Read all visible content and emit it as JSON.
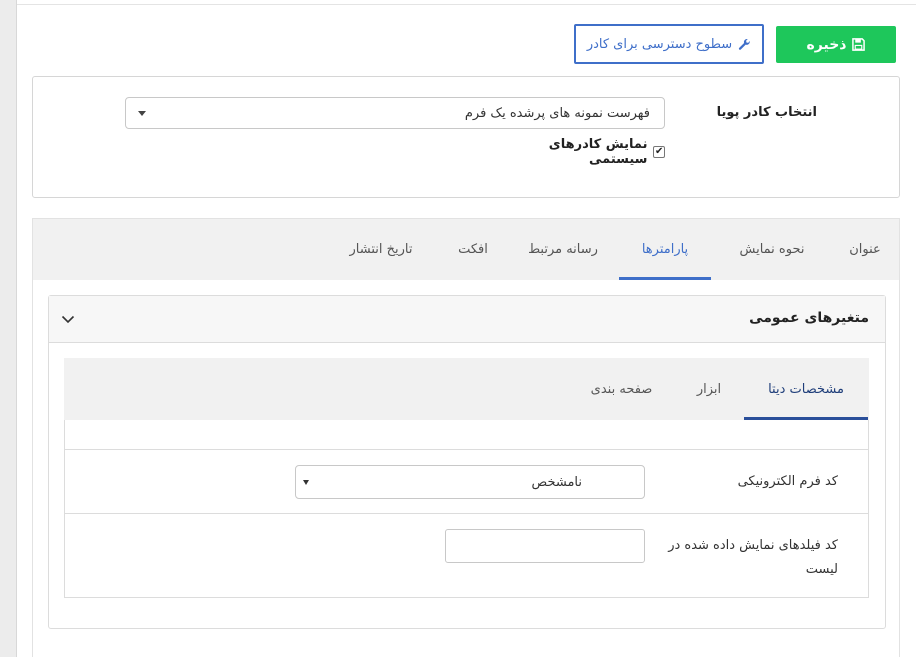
{
  "toolbar": {
    "save_label": "ذخیره",
    "save_icon": "floppy-disk-icon",
    "access_label": "سطوح دسترسی برای کادر",
    "access_icon": "wrench-icon"
  },
  "frame": {
    "label": "انتخاب کادر پویا",
    "selected": "فهرست نمونه های پرشده یک فرم",
    "show_system_label": "نمایش کادرهای سیستمی",
    "show_system_checked": true
  },
  "tabs": [
    {
      "label": "عنوان",
      "active": false
    },
    {
      "label": "نحوه نمایش",
      "active": false
    },
    {
      "label": "پارامترها",
      "active": true
    },
    {
      "label": "رسانه مرتبط",
      "active": false
    },
    {
      "label": "افکت",
      "active": false
    },
    {
      "label": "تاریخ انتشار",
      "active": false
    }
  ],
  "accordion": {
    "title": "متغیرهای عمومی",
    "icon": "chevron-down-icon"
  },
  "inner_tabs": [
    {
      "label": "مشخصات دیتا",
      "active": true
    },
    {
      "label": "ابزار",
      "active": false
    },
    {
      "label": "صفحه بندی",
      "active": false
    }
  ],
  "form": {
    "form_code_label": "کد فرم الکترونیکی",
    "form_code_value": "نامشخص",
    "fields_label": "کد فیلدهای نمایش داده شده در لیست",
    "fields_value": ""
  },
  "colors": {
    "save": "#1ec75b",
    "accent": "#3f6fc9",
    "inner_accent": "#2a4f9a"
  }
}
